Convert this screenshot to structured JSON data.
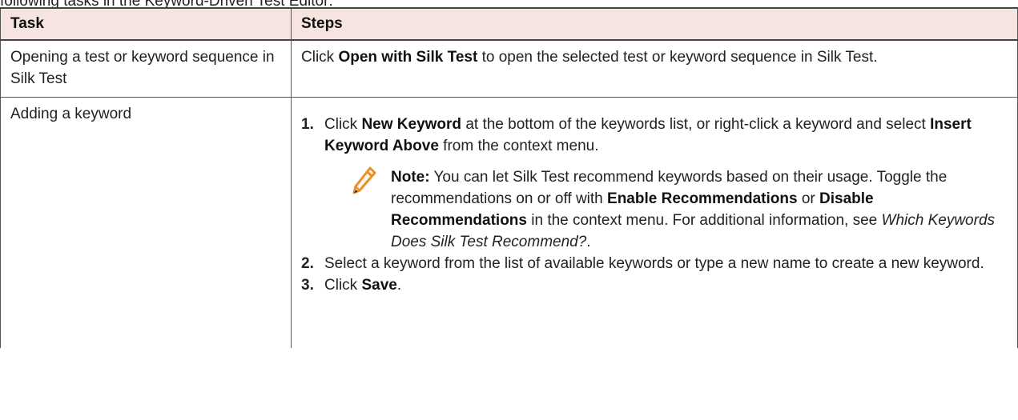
{
  "caption": "following tasks in the Keyword-Driven Test Editor:",
  "table": {
    "headers": {
      "task": "Task",
      "steps": "Steps"
    },
    "row1": {
      "task": "Opening a test or keyword sequence in Silk Test",
      "steps": {
        "pre": "Click ",
        "bold": "Open with Silk Test",
        "post": " to open the selected test or keyword sequence in Silk Test."
      }
    },
    "row2": {
      "task": "Adding a keyword",
      "step1": {
        "num": "1.",
        "a": "Click ",
        "b1": "New Keyword",
        "c": " at the bottom of the keywords list, or right-click a keyword and select ",
        "b2": "Insert Keyword Above",
        "d": " from the context menu."
      },
      "note": {
        "label": "Note:",
        "t1": " You can let Silk Test recommend keywords based on their usage. Toggle the recommendations on or off with ",
        "b1": "Enable Recommendations",
        "t2": " or ",
        "b2": "Disable Recommendations",
        "t3": " in the context menu. For additional information, see ",
        "link": "Which Keywords Does Silk Test Recommend?",
        "t4": ".",
        "icon": "pencil-icon"
      },
      "step2": {
        "num": "2.",
        "text": "Select a keyword from the list of available keywords or type a new name to create a new keyword."
      },
      "step3": {
        "num": "3.",
        "a": "Click ",
        "bold": "Save",
        "b": "."
      }
    }
  },
  "colors": {
    "header_bg": "#f5e4e0",
    "border": "#555555",
    "icon": "#e8902a"
  }
}
